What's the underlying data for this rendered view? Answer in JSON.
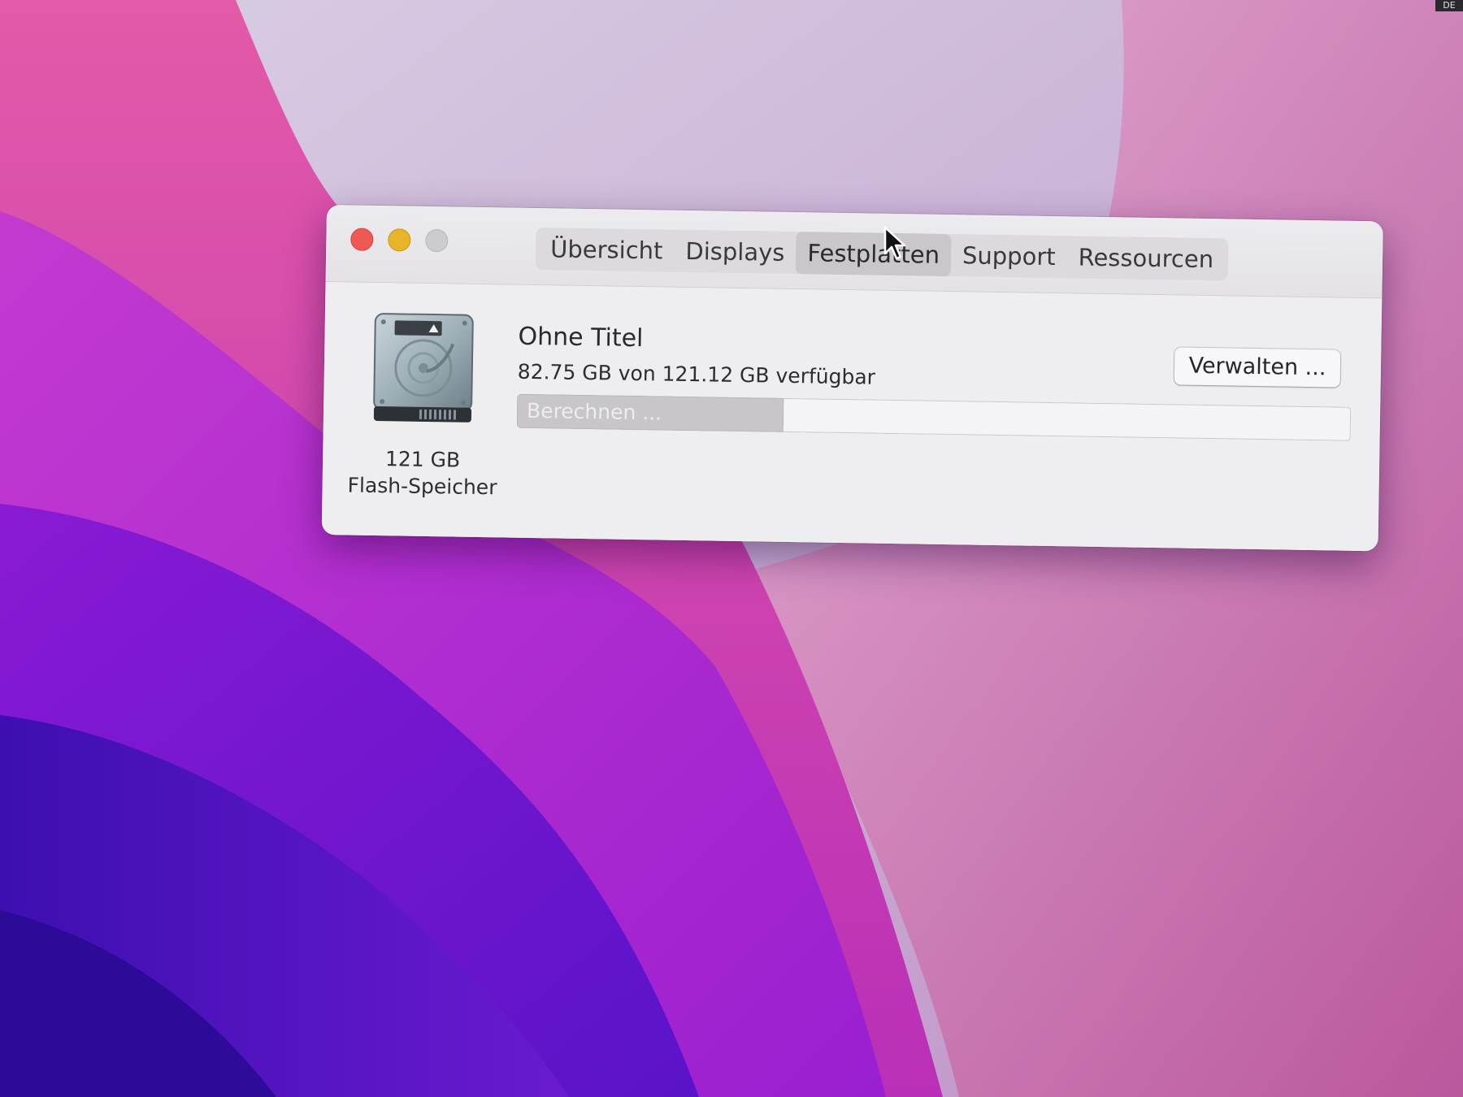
{
  "window": {
    "tabs": [
      {
        "label": "Übersicht",
        "active": false
      },
      {
        "label": "Displays",
        "active": false
      },
      {
        "label": "Festplatten",
        "active": true
      },
      {
        "label": "Support",
        "active": false
      },
      {
        "label": "Ressourcen",
        "active": false
      }
    ]
  },
  "disk": {
    "icon": "hard-drive-icon",
    "capacity": "121 GB",
    "type": "Flash-Speicher"
  },
  "volume": {
    "name": "Ohne Titel",
    "available": "82.75 GB von 121.12 GB verfügbar",
    "usage_status": "Berechnen ...",
    "used_fraction": 0.32
  },
  "actions": {
    "manage_label": "Verwalten ..."
  },
  "corner_badge": "DE",
  "colors": {
    "close": "#ee5a52",
    "minimize": "#e8b52a",
    "zoom": "#cdcbcf"
  }
}
